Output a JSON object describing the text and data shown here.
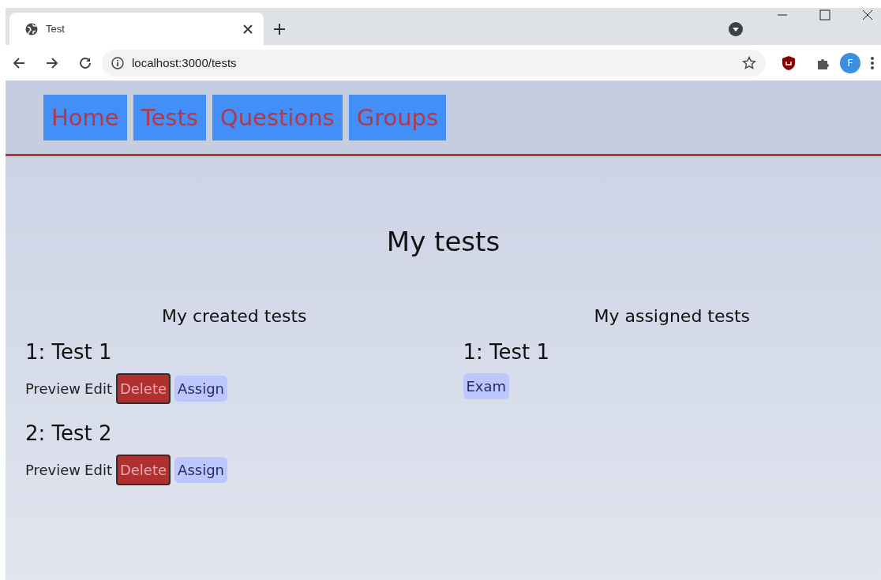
{
  "browser": {
    "tab_title": "Test",
    "address": "localhost:3000/tests",
    "profile_initial": "F"
  },
  "nav": [
    {
      "label": "Home"
    },
    {
      "label": "Tests"
    },
    {
      "label": "Questions"
    },
    {
      "label": "Groups"
    }
  ],
  "title": "My tests",
  "columns": [
    {
      "heading": "My created tests",
      "tests": [
        {
          "name": "1: Test 1",
          "actions": [
            {
              "label": "Preview",
              "kind": "link"
            },
            {
              "label": "Edit",
              "kind": "link"
            },
            {
              "label": "Delete",
              "kind": "danger"
            },
            {
              "label": "Assign",
              "kind": "pill"
            }
          ]
        },
        {
          "name": "2: Test 2",
          "actions": [
            {
              "label": "Preview",
              "kind": "link"
            },
            {
              "label": "Edit",
              "kind": "link"
            },
            {
              "label": "Delete",
              "kind": "danger"
            },
            {
              "label": "Assign",
              "kind": "pill"
            }
          ]
        }
      ]
    },
    {
      "heading": "My assigned tests",
      "tests": [
        {
          "name": "1: Test 1",
          "actions": [
            {
              "label": "Exam",
              "kind": "pill"
            }
          ]
        }
      ]
    }
  ]
}
